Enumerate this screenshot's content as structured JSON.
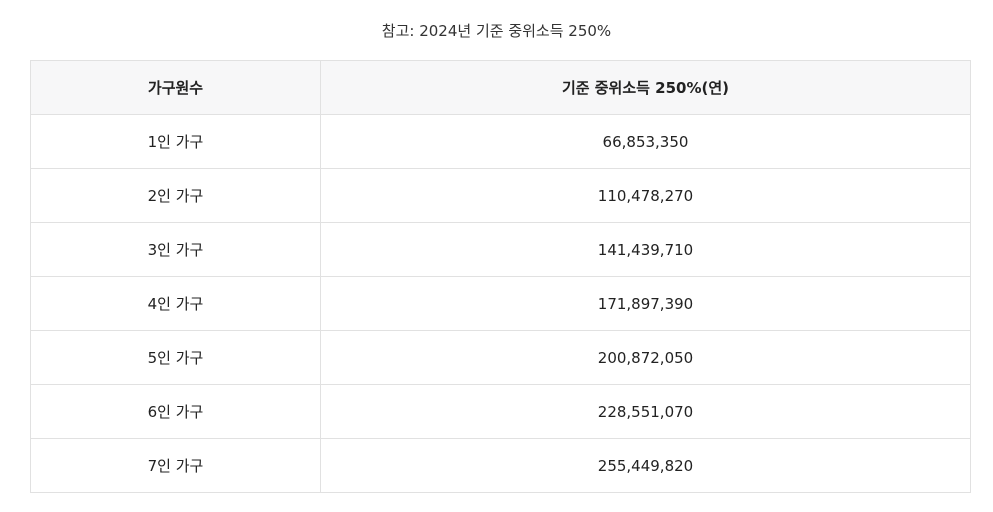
{
  "caption": "참고: 2024년 기준 중위소득 250%",
  "table": {
    "headers": [
      "가구원수",
      "기준 중위소득 250%(연)"
    ],
    "rows": [
      [
        "1인 가구",
        "66,853,350"
      ],
      [
        "2인 가구",
        "110,478,270"
      ],
      [
        "3인 가구",
        "141,439,710"
      ],
      [
        "4인 가구",
        "171,897,390"
      ],
      [
        "5인 가구",
        "200,872,050"
      ],
      [
        "6인 가구",
        "228,551,070"
      ],
      [
        "7인 가구",
        "255,449,820"
      ]
    ]
  }
}
